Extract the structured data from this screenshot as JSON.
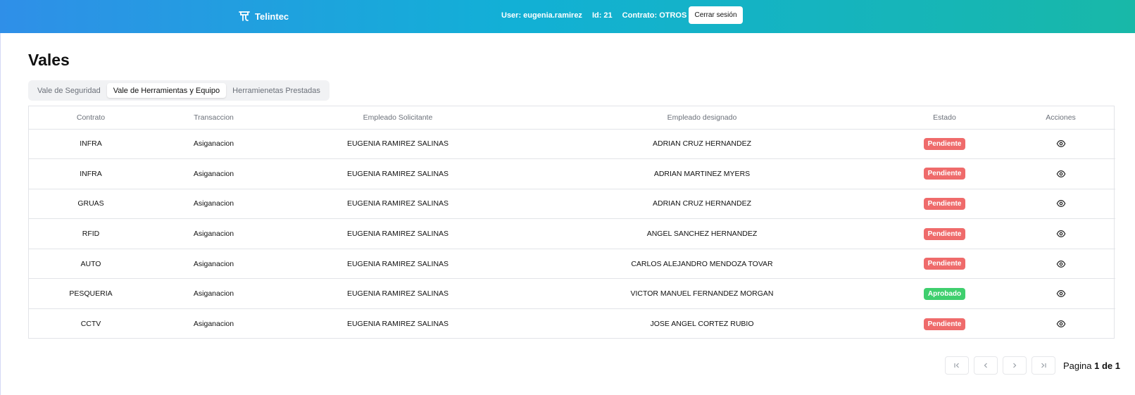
{
  "header": {
    "brand": "Telintec",
    "user_label": "User: eugenia.ramirez",
    "id_label": "Id: 21",
    "contract_label": "Contrato: OTROS",
    "logout_label": "Cerrar sesión",
    "colors": {
      "gradient_start": "#2f8fe8",
      "gradient_mid": "#12b0d6",
      "gradient_end": "#18b8a8"
    }
  },
  "page": {
    "title": "Vales"
  },
  "tabs": [
    {
      "label": "Vale de Seguridad",
      "active": false
    },
    {
      "label": "Vale de Herramientas y Equipo",
      "active": true
    },
    {
      "label": "Herramienetas Prestadas",
      "active": false
    }
  ],
  "table": {
    "columns": [
      "Contrato",
      "Transaccion",
      "Empleado Solicitante",
      "Empleado designado",
      "Estado",
      "Acciones"
    ],
    "rows": [
      {
        "contrato": "INFRA",
        "transaccion": "Asiganacion",
        "solicitante": "EUGENIA RAMIREZ SALINAS",
        "designado": "ADRIAN CRUZ HERNANDEZ",
        "estado": "Pendiente",
        "action_icon": "eye-icon"
      },
      {
        "contrato": "INFRA",
        "transaccion": "Asiganacion",
        "solicitante": "EUGENIA RAMIREZ SALINAS",
        "designado": "ADRIAN MARTINEZ MYERS",
        "estado": "Pendiente",
        "action_icon": "eye-icon"
      },
      {
        "contrato": "GRUAS",
        "transaccion": "Asiganacion",
        "solicitante": "EUGENIA RAMIREZ SALINAS",
        "designado": "ADRIAN CRUZ HERNANDEZ",
        "estado": "Pendiente",
        "action_icon": "eye-icon"
      },
      {
        "contrato": "RFID",
        "transaccion": "Asiganacion",
        "solicitante": "EUGENIA RAMIREZ SALINAS",
        "designado": "ANGEL SANCHEZ HERNANDEZ",
        "estado": "Pendiente",
        "action_icon": "eye-icon"
      },
      {
        "contrato": "AUTO",
        "transaccion": "Asiganacion",
        "solicitante": "EUGENIA RAMIREZ SALINAS",
        "designado": "CARLOS ALEJANDRO MENDOZA TOVAR",
        "estado": "Pendiente",
        "action_icon": "eye-icon"
      },
      {
        "contrato": "PESQUERIA",
        "transaccion": "Asiganacion",
        "solicitante": "EUGENIA RAMIREZ SALINAS",
        "designado": "VICTOR MANUEL FERNANDEZ MORGAN",
        "estado": "Aprobado",
        "action_icon": "eye-icon"
      },
      {
        "contrato": "CCTV",
        "transaccion": "Asiganacion",
        "solicitante": "EUGENIA RAMIREZ SALINAS",
        "designado": "JOSE ANGEL CORTEZ RUBIO",
        "estado": "Pendiente",
        "action_icon": "eye-icon"
      }
    ],
    "status_colors": {
      "Pendiente": "#ef6b6b",
      "Aprobado": "#3fcf6e"
    }
  },
  "pagination": {
    "prefix": "Pagina",
    "current": "1",
    "separator": "de",
    "total": "1",
    "buttons": [
      "first-page-icon",
      "previous-page-icon",
      "next-page-icon",
      "last-page-icon"
    ]
  }
}
